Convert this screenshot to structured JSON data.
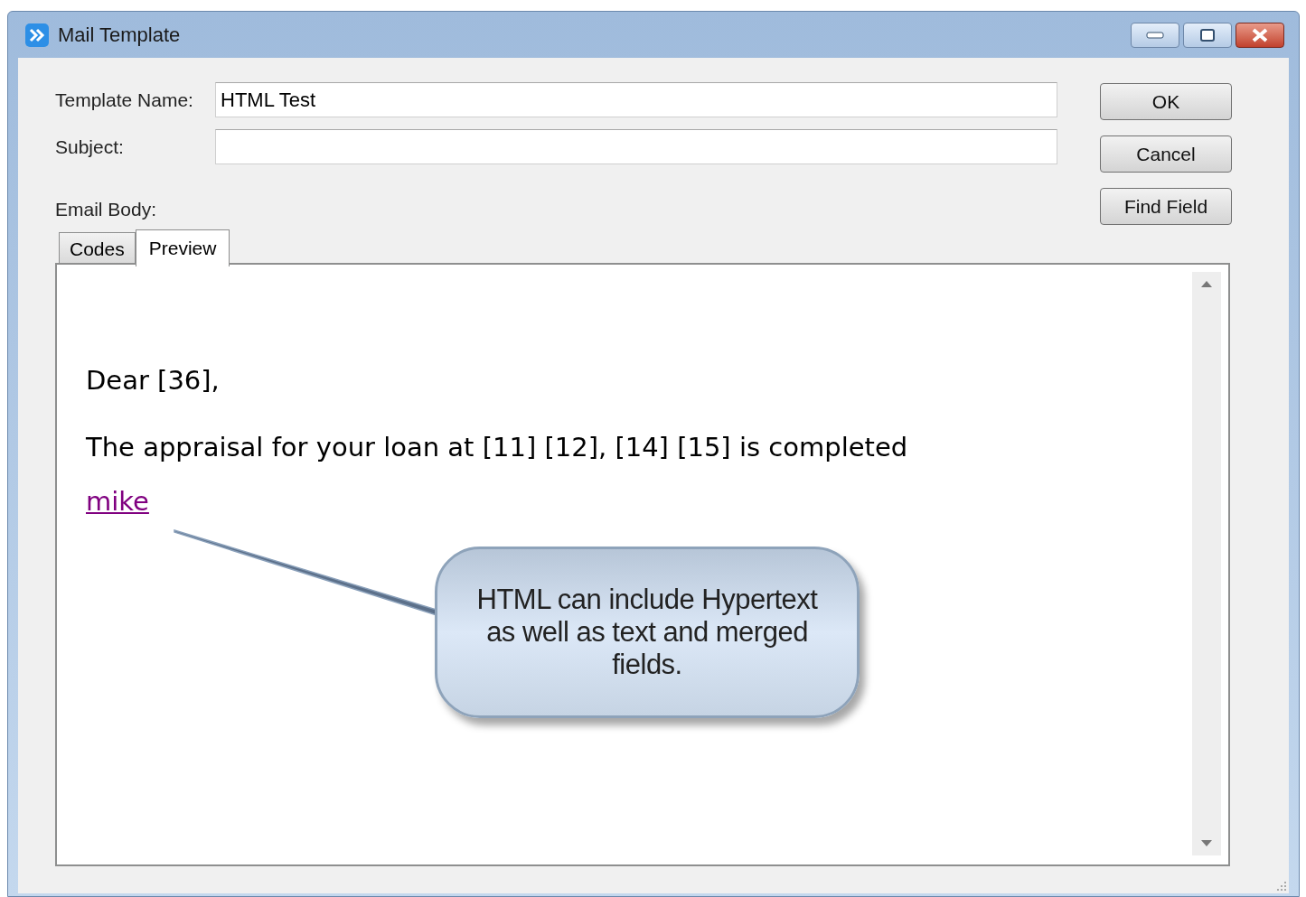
{
  "window": {
    "title": "Mail Template"
  },
  "fields": [
    {
      "label": "Template Name:",
      "value": "HTML Test"
    },
    {
      "label": "Subject:"
    }
  ],
  "buttons": [
    "OK",
    "Cancel",
    "Find Field"
  ],
  "body_label": "Email Body:",
  "tabs": [
    {
      "label": "Codes",
      "selected": false
    },
    {
      "label": "Preview",
      "selected": true
    }
  ],
  "preview": {
    "paragraphs": [
      "Dear [36],",
      "The appraisal for your loan at [11] [12], [14] [15] is completed"
    ],
    "link": "mike"
  },
  "callout": {
    "text": "HTML can include Hypertext as well as text and merged fields."
  }
}
